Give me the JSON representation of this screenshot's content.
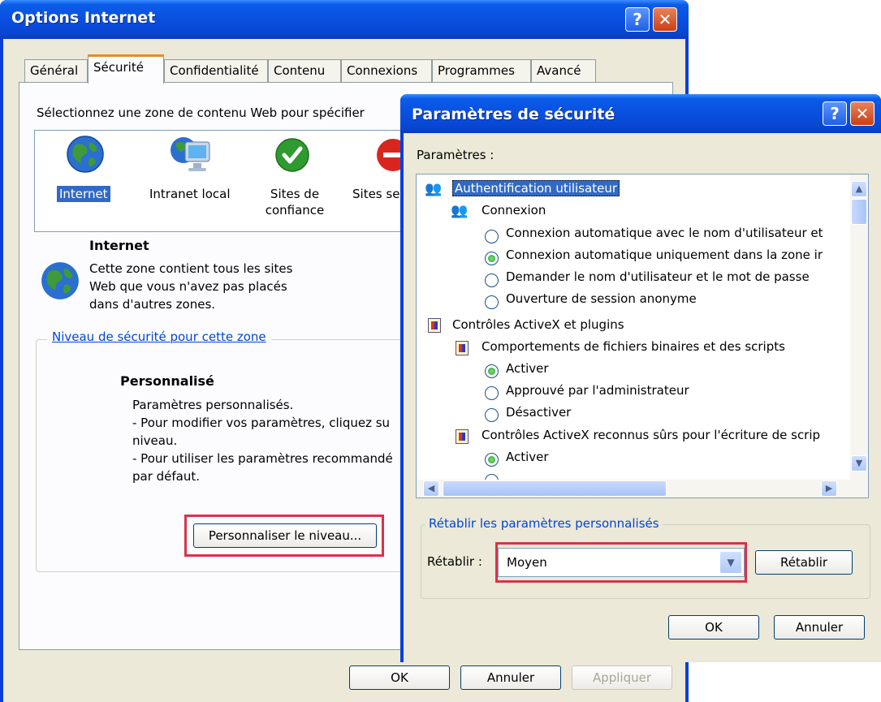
{
  "main_window": {
    "title": "Options Internet",
    "tabs": [
      "Général",
      "Sécurité",
      "Confidentialité",
      "Contenu",
      "Connexions",
      "Programmes",
      "Avancé"
    ],
    "zone_prompt": "Sélectionnez une zone de contenu Web pour spécifier",
    "zones": [
      {
        "label": "Internet",
        "icon": "globe-icon"
      },
      {
        "label": "Intranet local",
        "icon": "computer-icon"
      },
      {
        "label": "Sites de confiance",
        "icon": "green-check-icon"
      },
      {
        "label": "Sites se",
        "icon": "red-stop-icon"
      }
    ],
    "zone_name": "Internet",
    "zone_desc_1": "Cette zone contient tous les sites",
    "zone_desc_2": "Web que vous n'avez pas placés",
    "zone_desc_3": "dans d'autres zones.",
    "level_group_label": "Niveau de sécurité pour cette zone",
    "level_title": "Personnalisé",
    "level_lines": [
      "Paramètres personnalisés.",
      "- Pour modifier vos paramètres, cliquez su",
      "niveau.",
      "- Pour utiliser les paramètres recommandé",
      "par défaut."
    ],
    "custom_level_button": "Personnaliser le niveau...",
    "ok_button": "OK",
    "cancel_button": "Annuler",
    "apply_button": "Appliquer"
  },
  "security_dialog": {
    "title": "Paramètres de sécurité",
    "settings_label": "Paramètres :",
    "tree": [
      {
        "text": "Authentification utilisateur",
        "kind": "user-header",
        "selected": true
      },
      {
        "text": "Connexion",
        "kind": "user-sub"
      },
      {
        "text": "Connexion automatique avec le nom d'utilisateur et",
        "kind": "radio",
        "checked": false
      },
      {
        "text": "Connexion automatique uniquement dans la zone ir",
        "kind": "radio",
        "checked": true
      },
      {
        "text": "Demander le nom d'utilisateur et le mot de passe",
        "kind": "radio",
        "checked": false
      },
      {
        "text": "Ouverture de session anonyme",
        "kind": "radio",
        "checked": false
      },
      {
        "text": "Contrôles ActiveX et plugins",
        "kind": "shield-header"
      },
      {
        "text": "Comportements de fichiers binaires et des scripts",
        "kind": "shield-sub"
      },
      {
        "text": "Activer",
        "kind": "radio",
        "checked": true
      },
      {
        "text": "Approuvé par l'administrateur",
        "kind": "radio",
        "checked": false
      },
      {
        "text": "Désactiver",
        "kind": "radio",
        "checked": false
      },
      {
        "text": "Contrôles ActiveX reconnus sûrs pour l'écriture de scrip",
        "kind": "shield-sub"
      },
      {
        "text": "Activer",
        "kind": "radio",
        "checked": true
      }
    ],
    "reset_group_label": "Rétablir les paramètres personnalisés",
    "reset_label": "Rétablir :",
    "reset_value": "Moyen",
    "reset_button": "Rétablir",
    "ok_button": "OK",
    "cancel_button": "Annuler"
  },
  "colors": {
    "titlebar": "#0a4fe0",
    "dialog_bg": "#ece9d8",
    "highlight_box": "#d8334b",
    "selection": "#316ac5",
    "group_label": "#0046d5"
  }
}
